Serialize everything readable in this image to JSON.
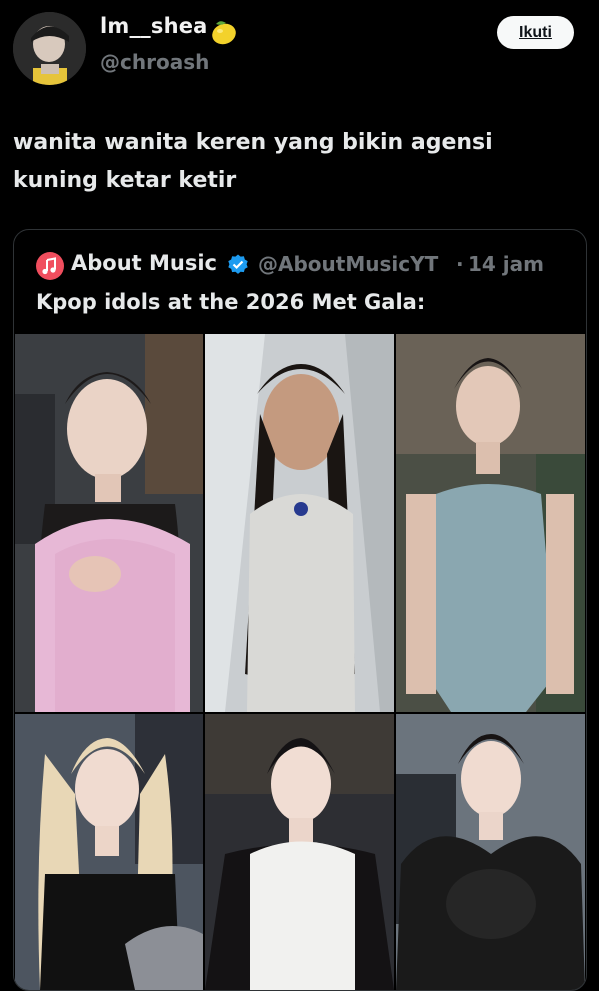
{
  "tweet": {
    "author_name": "lm__shea",
    "author_handle": "@chroash",
    "follow_label": "Ikuti",
    "text": "wanita wanita keren yang bikin agensi kuning ketar ketir",
    "emoji_icon": "lemon-icon"
  },
  "quoted": {
    "author_name": "About Music",
    "author_handle": "@AboutMusicYT",
    "separator": "·",
    "time": "14 jam",
    "text": "Kpop idols at the 2026 Met Gala:",
    "verified_color": "#1d9bf0",
    "avatar_color": "#f04e5e",
    "photos": [
      {
        "name": "photo-1",
        "dress": "#e7b8d6",
        "bg": "#3b3e42",
        "hair": "#1d1a1a"
      },
      {
        "name": "photo-2",
        "dress": "#d9d9d6",
        "bg": "#c9cdd0",
        "hair": "#1a1512"
      },
      {
        "name": "photo-3",
        "dress": "#8aa7b0",
        "bg": "#4b4f45",
        "hair": "#181414"
      },
      {
        "name": "photo-4",
        "dress": "#111111",
        "bg": "#4d5560",
        "hair": "#e8d7b6"
      },
      {
        "name": "photo-5",
        "dress": "#f1f1ef",
        "bg": "#2d2e33",
        "hair": "#141214"
      },
      {
        "name": "photo-6",
        "dress": "#1a1a1a",
        "bg": "#6b747d",
        "hair": "#171313"
      }
    ]
  }
}
